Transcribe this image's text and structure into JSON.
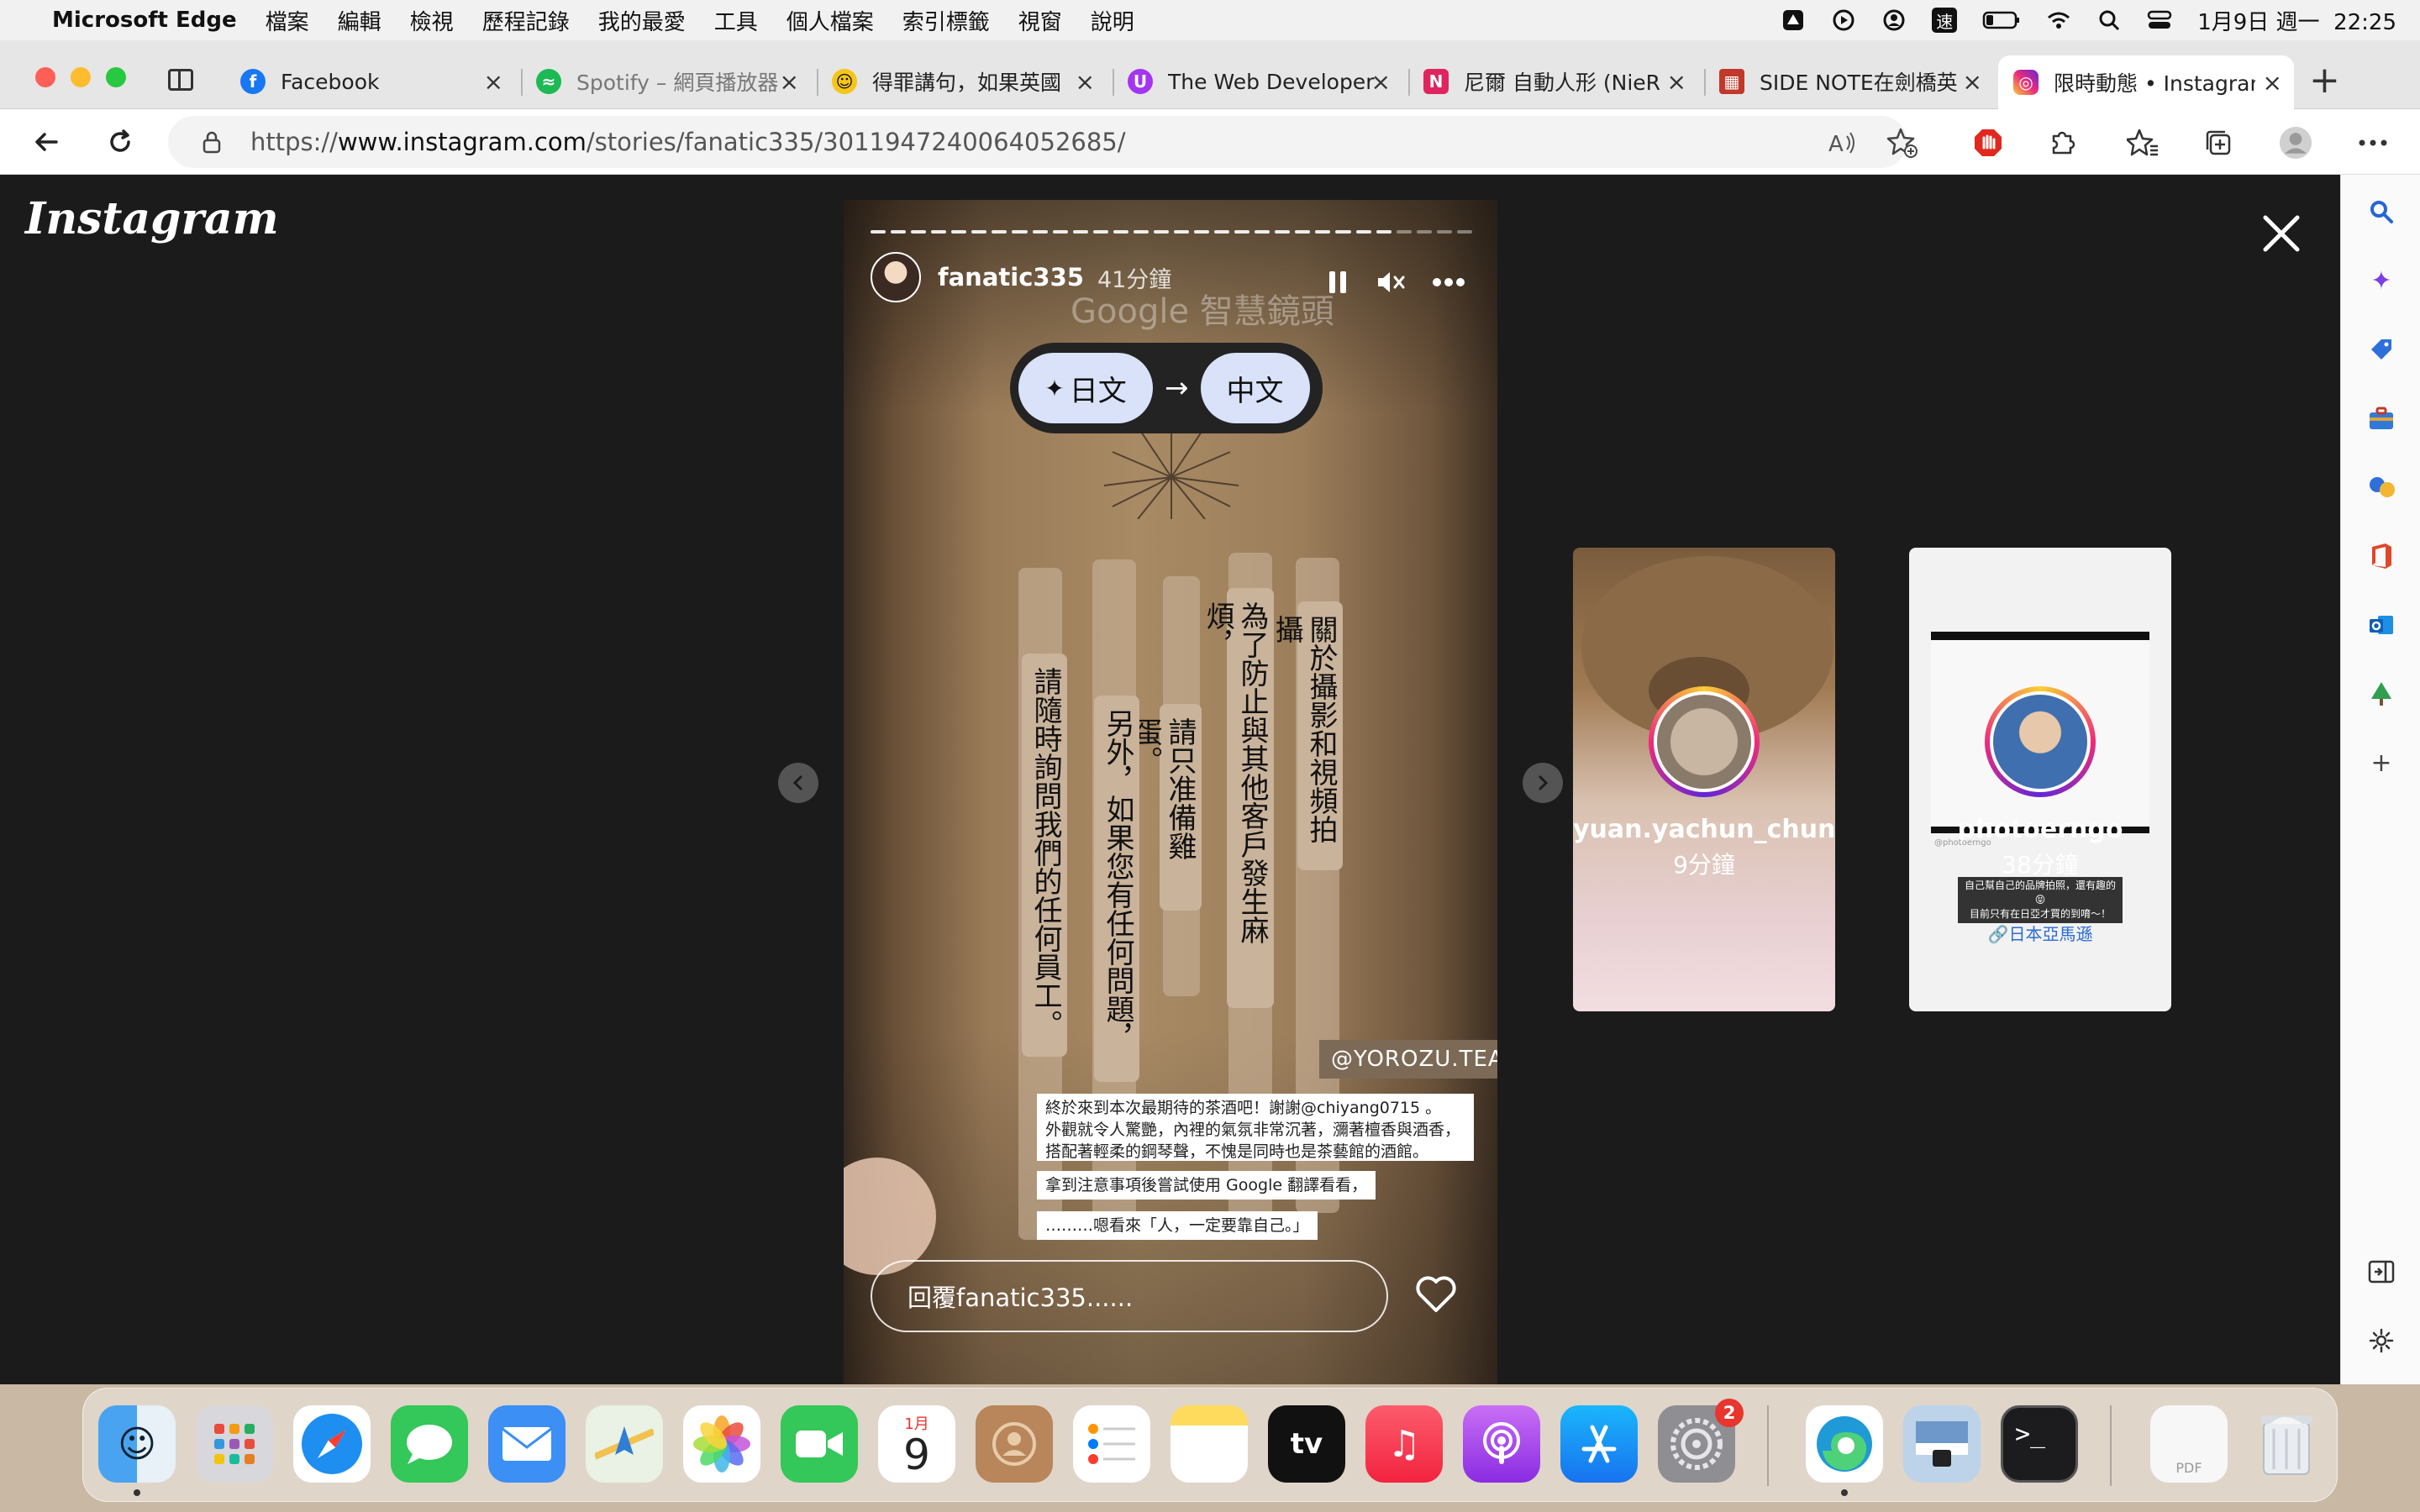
{
  "menubar": {
    "app": "Microsoft Edge",
    "items": [
      "檔案",
      "編輯",
      "檢視",
      "歷程記錄",
      "我的最愛",
      "工具",
      "個人檔案",
      "索引標籤",
      "視窗",
      "說明"
    ],
    "input_method": "速",
    "datetime": "1月9日 週一  22:25"
  },
  "tabs": [
    {
      "title": "Facebook",
      "icon": "facebook-icon",
      "color": "#1877f2"
    },
    {
      "title": "Spotify – 網頁播放器",
      "icon": "spotify-icon",
      "color": "#1db954"
    },
    {
      "title": "得罪講句，如果英國",
      "icon": "smiley-icon",
      "color": "#f5c518"
    },
    {
      "title": "The Web Developer",
      "icon": "udemy-icon",
      "color": "#a435f0"
    },
    {
      "title": "尼爾 自動人形 (NieR",
      "icon": "nier-icon",
      "color": "#e0245e"
    },
    {
      "title": "SIDE NOTE在劍橋英",
      "icon": "cambridge-icon",
      "color": "#c0392b"
    },
    {
      "title": "限時動態 • Instagram",
      "icon": "instagram-icon",
      "color": "#e1306c"
    }
  ],
  "address": {
    "scheme": "https://",
    "domain": "www.instagram.com",
    "path": "/stories/fanatic335/3011947240064052685/"
  },
  "instagram": {
    "logo": "Instagram",
    "story": {
      "username": "fanatic335",
      "time": "41分鐘",
      "lens_overlay": "Google 智慧鏡頭",
      "translate_from": "日文",
      "translate_to": "中文",
      "strips": [
        "關於攝影和視頻拍攝",
        "為了防止與其他客戶發生麻煩，",
        "請只准備雞蛋。",
        "另外，如果您有任何問題，",
        "請隨時詢問我們的任何員工。"
      ],
      "tag": "@YOROZU.TEA",
      "caption_1": "終於來到本次最期待的茶酒吧！謝謝@chiyang0715 。",
      "caption_2": "外觀就令人驚艷，內裡的氣氛非常沉著，瀰著檀香與酒香，",
      "caption_3": "搭配著輕柔的鋼琴聲，不愧是同時也是茶藝館的酒館。",
      "caption_4": "拿到注意事項後嘗試使用 Google 翻譯看看，",
      "caption_5": "………嗯看來「人，一定要靠自己。」",
      "reply_placeholder": "回覆fanatic335......"
    },
    "previews": [
      {
        "username": "yuan.yachun_chun",
        "time": "9分鐘"
      },
      {
        "username": "photoerngo",
        "time": "38分鐘",
        "caption_1": "自己幫自己的品牌拍照，還有趣的😝",
        "caption_2": "目前只有在日亞才買的到唷～！",
        "link": "🔗日本亞馬遜",
        "mini_handle": "@photoerngo"
      }
    ]
  },
  "dock": {
    "calendar_month": "1月",
    "calendar_day": "9",
    "settings_badge": "2",
    "tv_label": "tv",
    "pdf_label": "PDF"
  }
}
